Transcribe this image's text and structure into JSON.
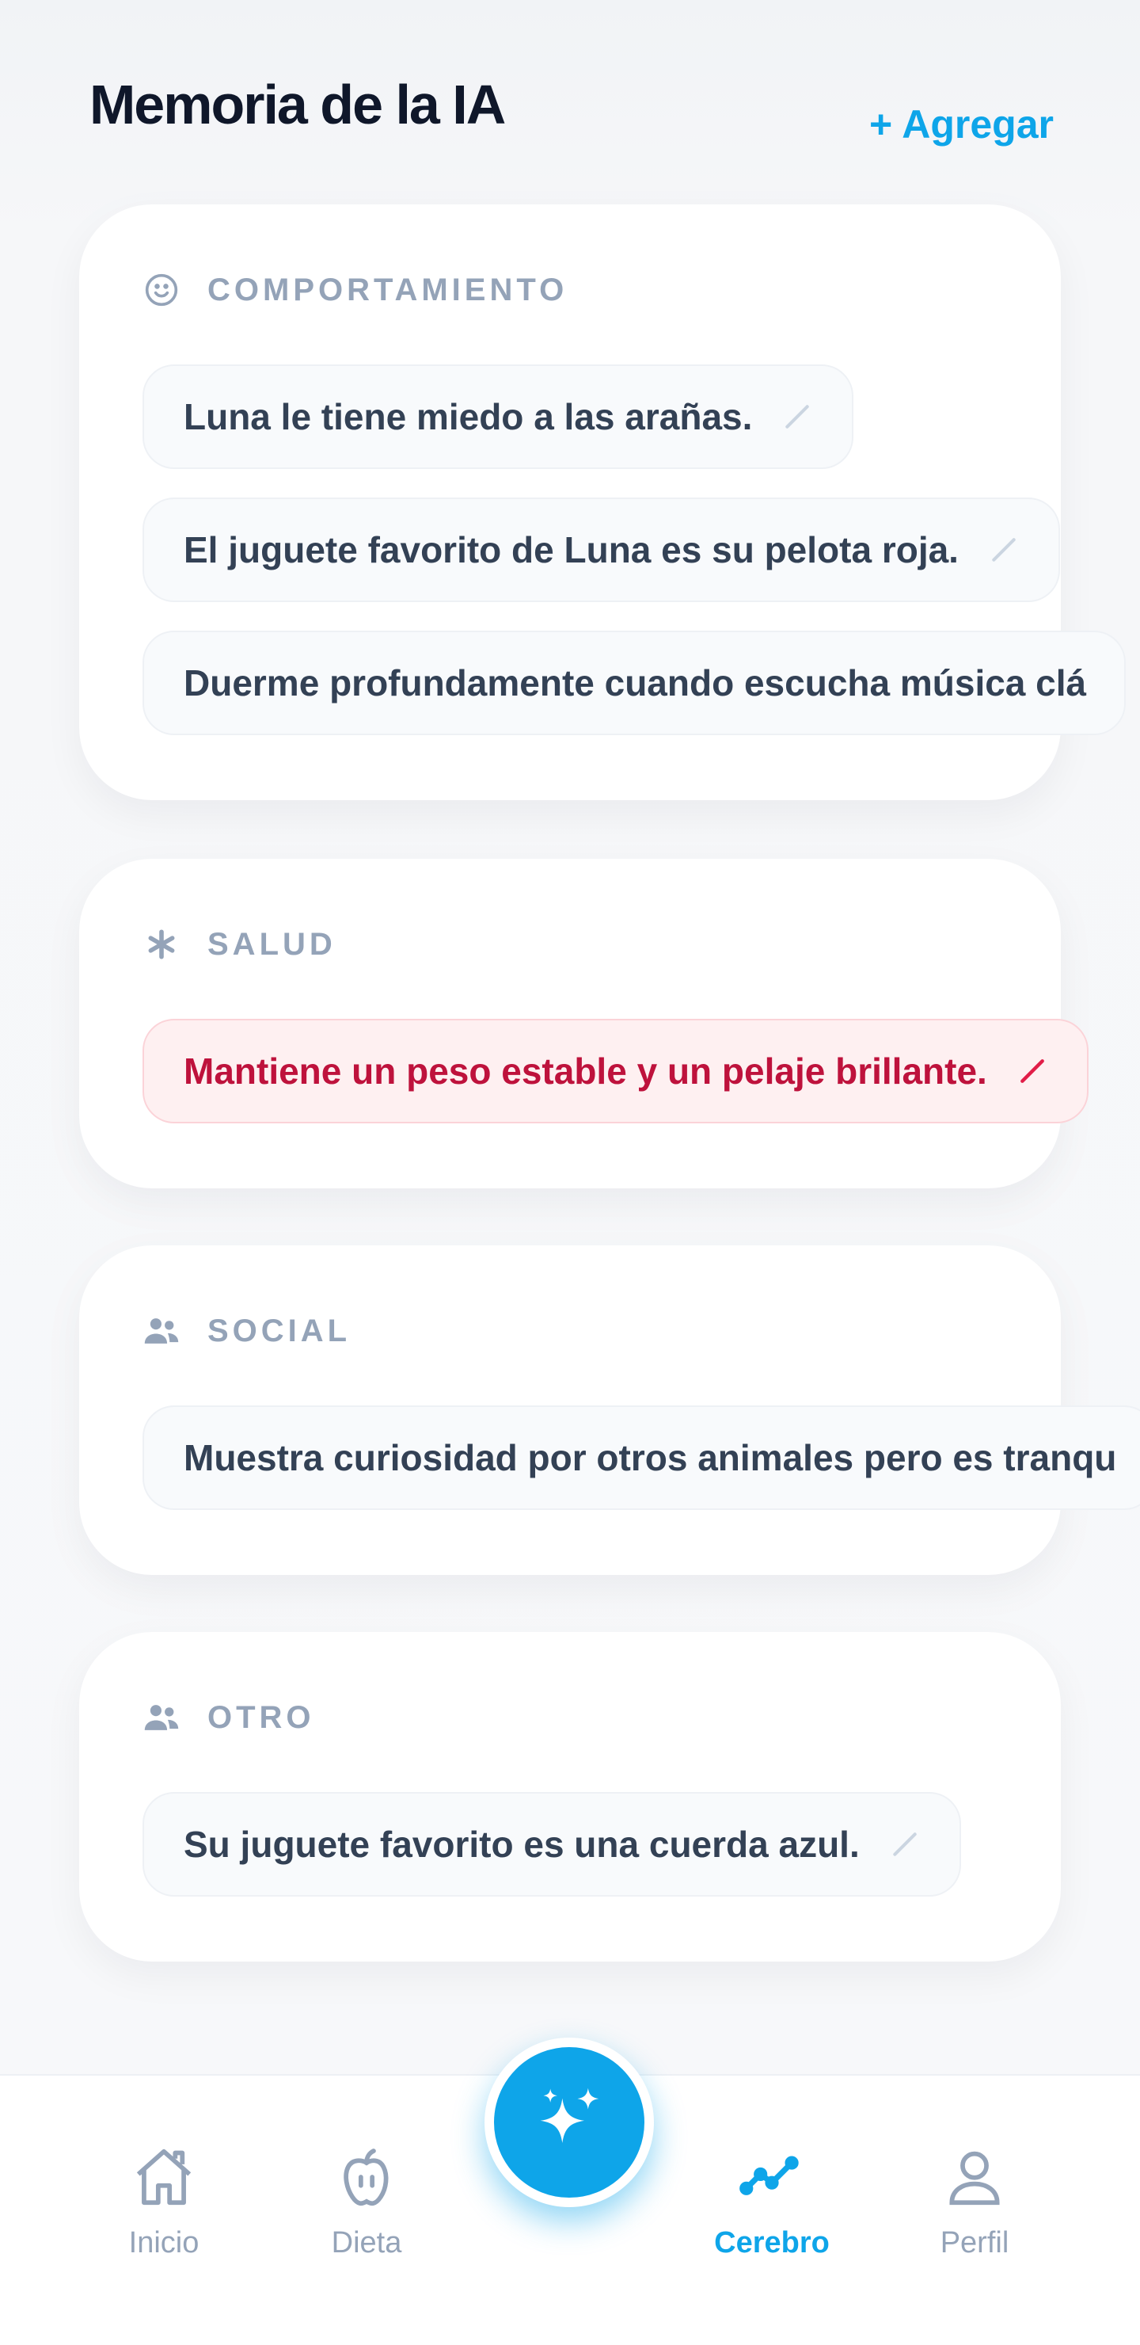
{
  "header": {
    "title": "Memoria de la IA",
    "add_label": "+ Agregar"
  },
  "categories": [
    {
      "label": "COMPORTAMIENTO",
      "icon": "smile-icon",
      "items": [
        "Luna le tiene miedo a las arañas.",
        "El juguete favorito de Luna es su pelota roja.",
        "Duerme profundamente cuando escucha música clá"
      ]
    },
    {
      "label": "SALUD",
      "icon": "asterisk-icon",
      "items": [
        "Mantiene un peso estable y un pelaje brillante."
      ]
    },
    {
      "label": "SOCIAL",
      "icon": "people-icon",
      "items": [
        "Muestra curiosidad por otros animales pero es tranqu"
      ]
    },
    {
      "label": "OTRO",
      "icon": "people-icon",
      "items": [
        "Su juguete favorito es una cuerda azul."
      ]
    }
  ],
  "nav": {
    "items": [
      {
        "label": "Inicio",
        "icon": "home-icon"
      },
      {
        "label": "Dieta",
        "icon": "apple-icon"
      },
      {
        "label": "Cerebro",
        "icon": "trend-icon",
        "active": true
      },
      {
        "label": "Perfil",
        "icon": "user-icon"
      }
    ],
    "fab_icon": "sparkles-icon"
  },
  "colors": {
    "accent": "#0ea5e9",
    "health_text": "#be123c",
    "health_bg": "#fef0f1",
    "muted": "#94a3b8"
  }
}
